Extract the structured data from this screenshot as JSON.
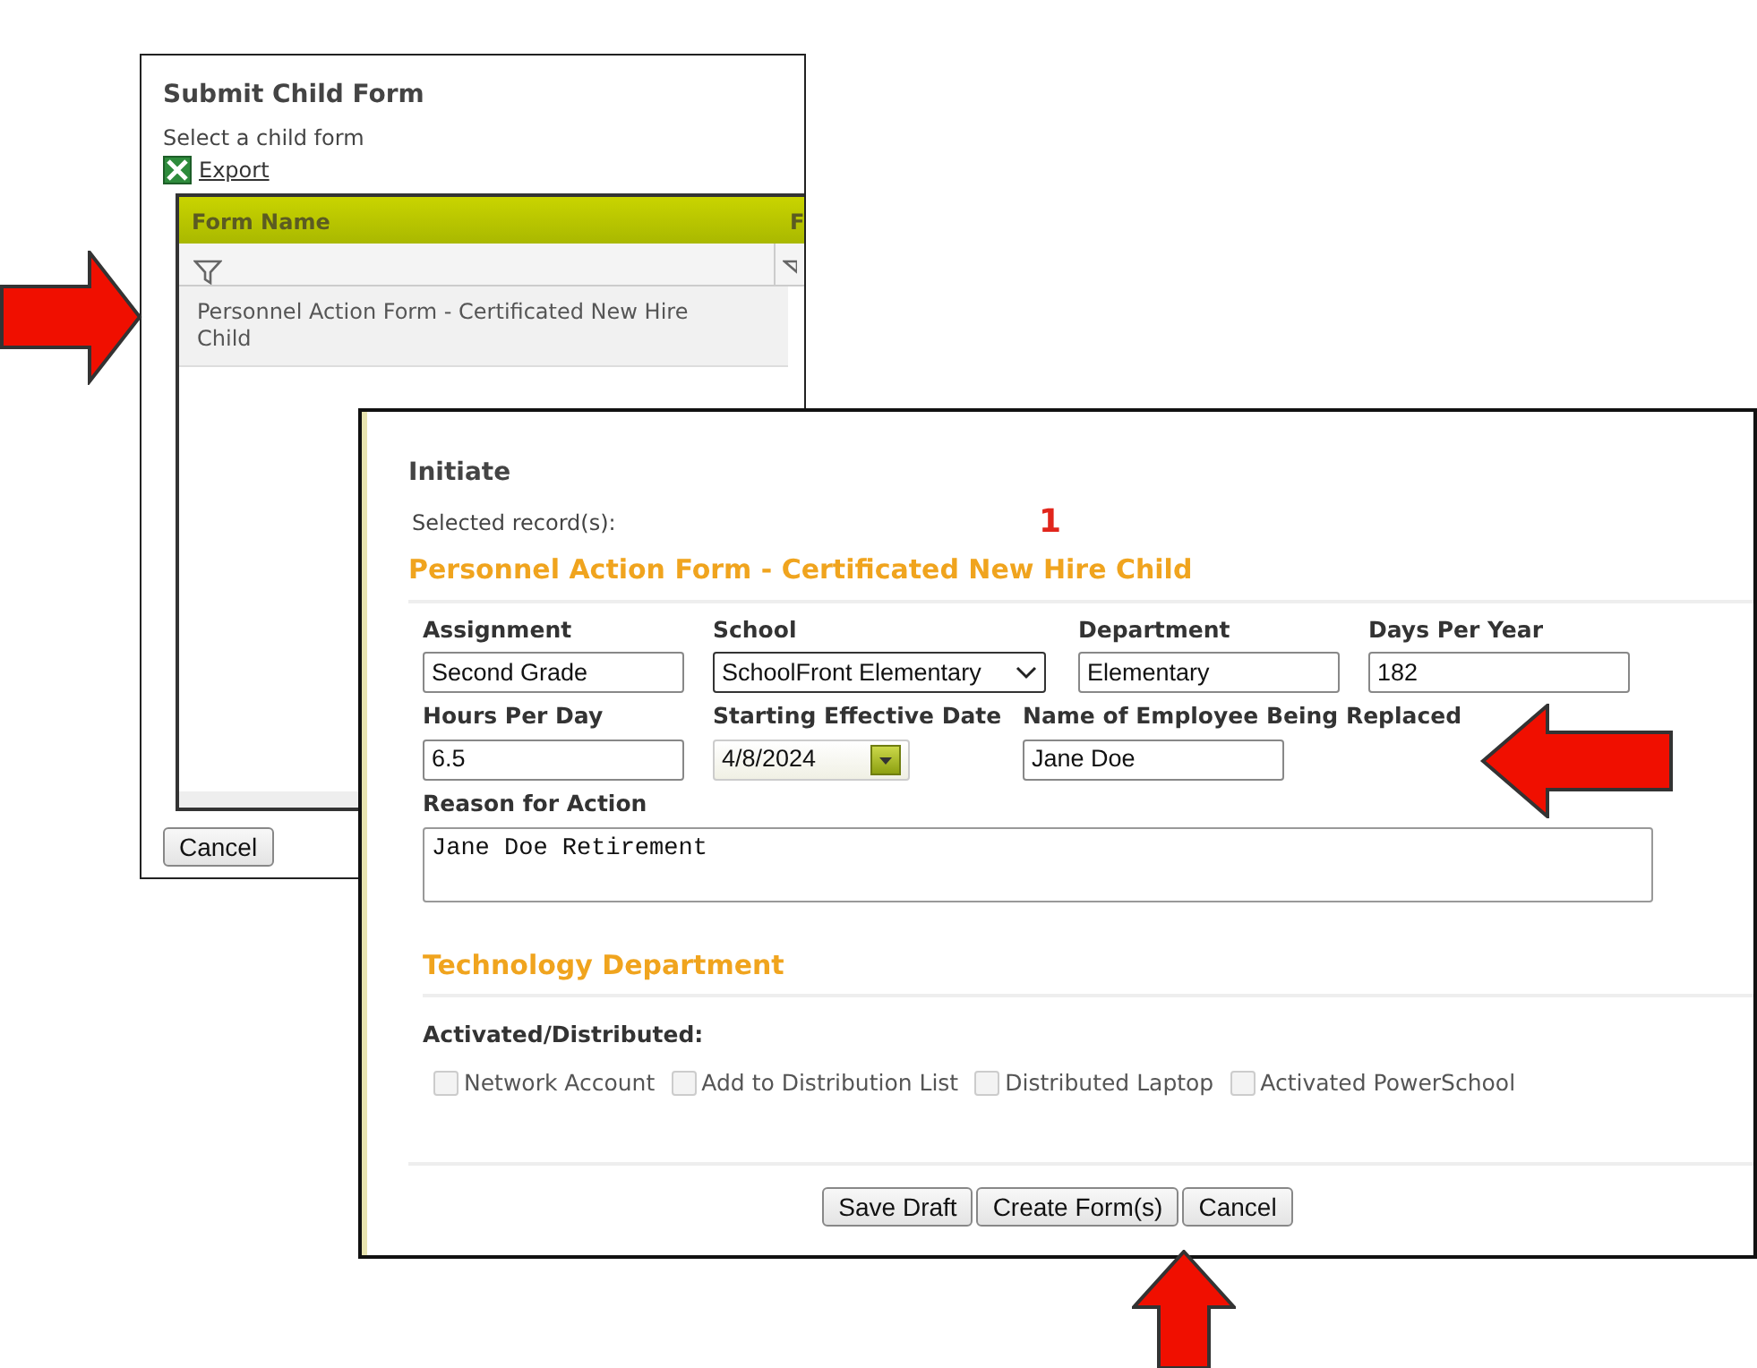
{
  "child_dialog": {
    "title": "Submit Child Form",
    "subtitle": "Select a child form",
    "export_link": "Export",
    "grid": {
      "columns": [
        {
          "label": "Form Name"
        },
        {
          "label": "F"
        }
      ],
      "rows": [
        {
          "form_name": "Personnel Action Form - Certificated New Hire Child"
        }
      ]
    },
    "buttons": [
      "Cancel"
    ]
  },
  "initiate_dialog": {
    "title": "Initiate",
    "selected_records_label": "Selected record(s):",
    "selected_records_count": "1",
    "section_title": "Personnel Action Form - Certificated New Hire Child",
    "field_rows": [
      [
        {
          "kind": "text",
          "label": "Assignment",
          "value": "Second Grade"
        },
        {
          "kind": "select",
          "label": "School",
          "value": "SchoolFront Elementary"
        },
        {
          "kind": "text",
          "label": "Department",
          "value": "Elementary"
        },
        {
          "kind": "text",
          "label": "Days Per Year",
          "value": "182"
        }
      ],
      [
        {
          "kind": "text",
          "label": "Hours Per Day",
          "value": "6.5"
        },
        {
          "kind": "date",
          "label": "Starting Effective Date",
          "value": "4/8/2024"
        },
        {
          "kind": "text",
          "label": "Name of Employee Being Replaced",
          "value": "Jane Doe"
        }
      ],
      [
        {
          "kind": "textarea",
          "label": "Reason for Action",
          "value": "Jane Doe Retirement"
        }
      ]
    ],
    "tech_section_title": "Technology Department",
    "checkbox_group_label": "Activated/Distributed:",
    "checkboxes": [
      {
        "label": "Network Account",
        "checked": false,
        "disabled": true
      },
      {
        "label": "Add to Distribution List",
        "checked": false,
        "disabled": true
      },
      {
        "label": "Distributed Laptop",
        "checked": false,
        "disabled": true
      },
      {
        "label": "Activated PowerSchool",
        "checked": false,
        "disabled": true
      }
    ],
    "buttons": [
      "Save Draft",
      "Create Form(s)",
      "Cancel"
    ]
  },
  "callout_arrows": [
    {
      "kind": "right"
    },
    {
      "kind": "left"
    },
    {
      "kind": "up"
    }
  ]
}
